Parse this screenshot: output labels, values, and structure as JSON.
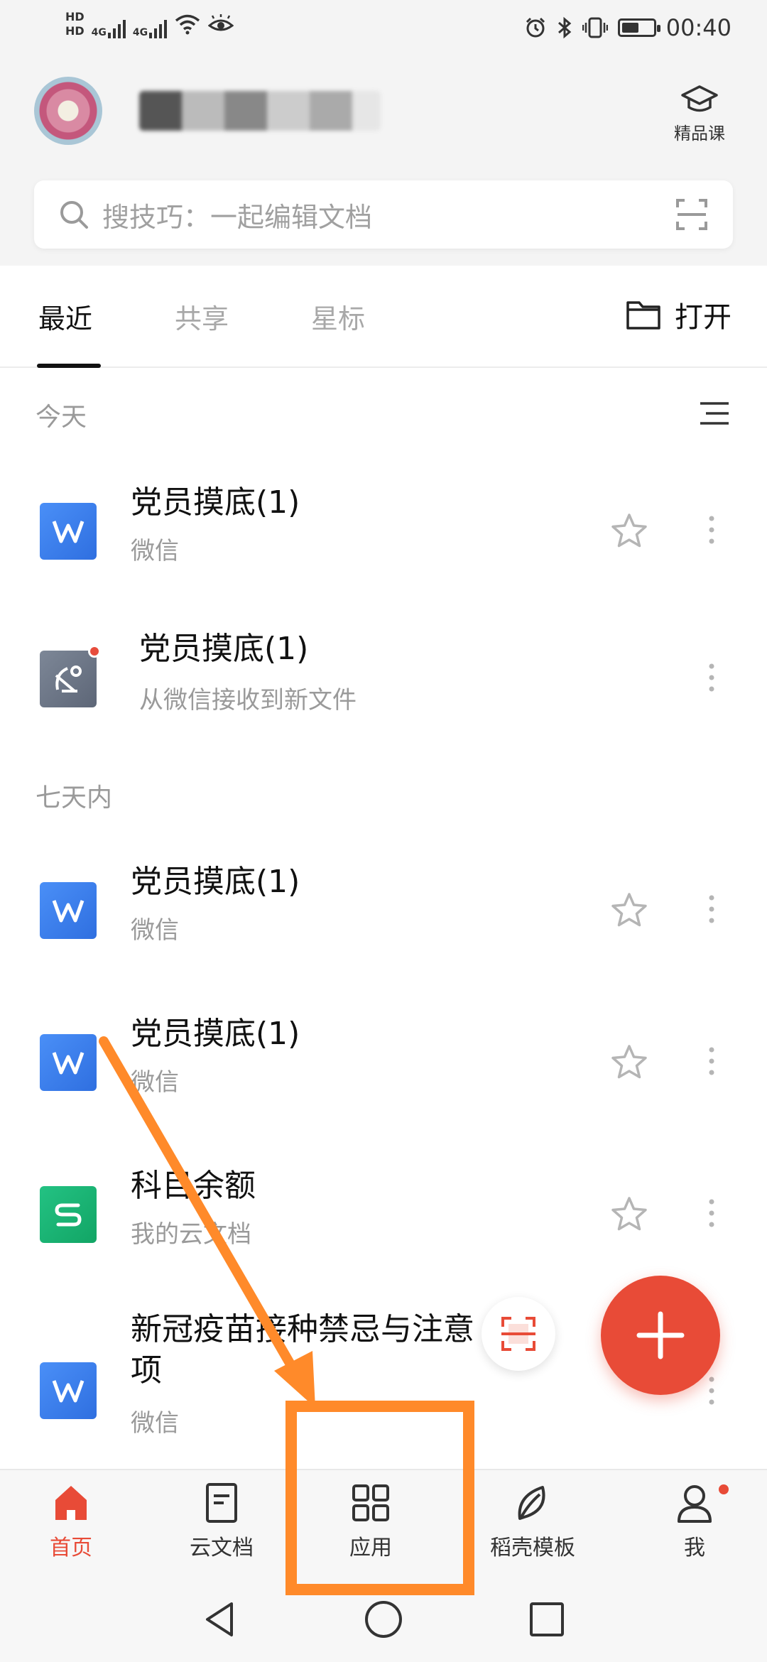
{
  "status_bar": {
    "hd1": "HD",
    "hd2": "HD",
    "net1": "4G",
    "net2": "4G",
    "time": "00:40",
    "battery_level": 0.55
  },
  "header": {
    "course_label": "精品课"
  },
  "search": {
    "placeholder": "搜技巧：一起编辑文档"
  },
  "tabs": {
    "recent": "最近",
    "shared": "共享",
    "starred": "星标",
    "open": "打开"
  },
  "sections": {
    "today": "今天",
    "week": "七天内"
  },
  "files": [
    {
      "title": "党员摸底(1)",
      "source": "微信",
      "type": "word",
      "starred": false
    },
    {
      "title": "党员摸底(1)",
      "source": "从微信接收到新文件",
      "type": "message",
      "starred": false,
      "has_badge": true
    },
    {
      "title": "党员摸底(1)",
      "source": "微信",
      "type": "word",
      "starred": false
    },
    {
      "title": "党员摸底(1)",
      "source": "微信",
      "type": "word",
      "starred": false
    },
    {
      "title": "科目余额",
      "source": "我的云文档",
      "type": "sheet",
      "starred": false
    },
    {
      "title_line1": "新冠疫苗接种禁忌与注意",
      "title_line2": "项",
      "source": "微信",
      "type": "word",
      "starred": false
    }
  ],
  "bottom_nav": {
    "home": "首页",
    "cloud": "云文档",
    "apps": "应用",
    "templates": "稻壳模板",
    "me": "我"
  },
  "colors": {
    "accent": "#e84b37",
    "word_blue": "#3a7ff0",
    "sheet_green": "#1ab473",
    "annotation_orange": "#ff8a2a"
  }
}
